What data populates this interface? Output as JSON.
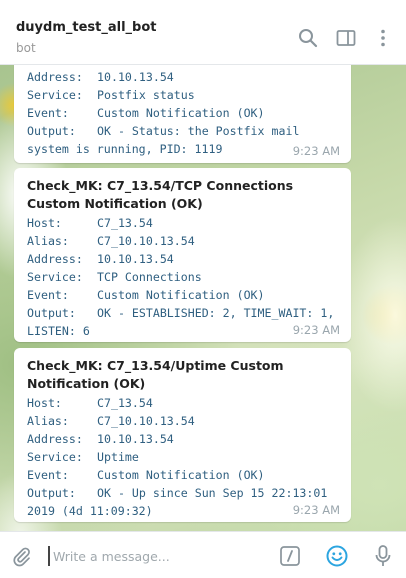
{
  "header": {
    "title": "duydm_test_all_bot",
    "subtitle": "bot",
    "icons": [
      "search-icon",
      "sidebar-toggle-icon",
      "more-vertical-icon"
    ]
  },
  "messages": [
    {
      "title": "",
      "rows": [
        {
          "key": "Address:",
          "value": "10.10.13.54"
        },
        {
          "key": "Service:",
          "value": "Postfix status"
        },
        {
          "key": "Event:",
          "value": "Custom Notification (OK)"
        },
        {
          "key": "Output:",
          "value": "OK - Status: the Postfix mail system is running, PID: 1119"
        }
      ],
      "time": "9:23 AM"
    },
    {
      "title": "Check_MK: C7_13.54/TCP Connections Custom Notification (OK)",
      "rows": [
        {
          "key": "Host:",
          "value": "C7_13.54"
        },
        {
          "key": "Alias:",
          "value": "C7_10.10.13.54"
        },
        {
          "key": "Address:",
          "value": "10.10.13.54"
        },
        {
          "key": "Service:",
          "value": "TCP Connections"
        },
        {
          "key": "Event:",
          "value": "Custom Notification (OK)"
        },
        {
          "key": "Output:",
          "value": "OK - ESTABLISHED: 2, TIME_WAIT: 1, LISTEN: 6"
        }
      ],
      "time": "9:23 AM"
    },
    {
      "title": "Check_MK: C7_13.54/Uptime Custom Notification (OK)",
      "rows": [
        {
          "key": "Host:",
          "value": "C7_13.54"
        },
        {
          "key": "Alias:",
          "value": "C7_10.10.13.54"
        },
        {
          "key": "Address:",
          "value": "10.10.13.54"
        },
        {
          "key": "Service:",
          "value": "Uptime"
        },
        {
          "key": "Event:",
          "value": "Custom Notification (OK)"
        },
        {
          "key": "Output:",
          "value": "OK - Up since Sun Sep 15 22:13:01 2019 (4d 11:09:32)"
        }
      ],
      "time": "9:23 AM"
    }
  ],
  "composer": {
    "placeholder": "Write a message...",
    "icons": [
      "attach-icon",
      "bot-command-icon",
      "emoji-icon",
      "microphone-icon"
    ]
  },
  "colors": {
    "accent": "#2ca5e0",
    "monospace_text": "#2f5f80",
    "time_text": "#9aa6ad"
  }
}
